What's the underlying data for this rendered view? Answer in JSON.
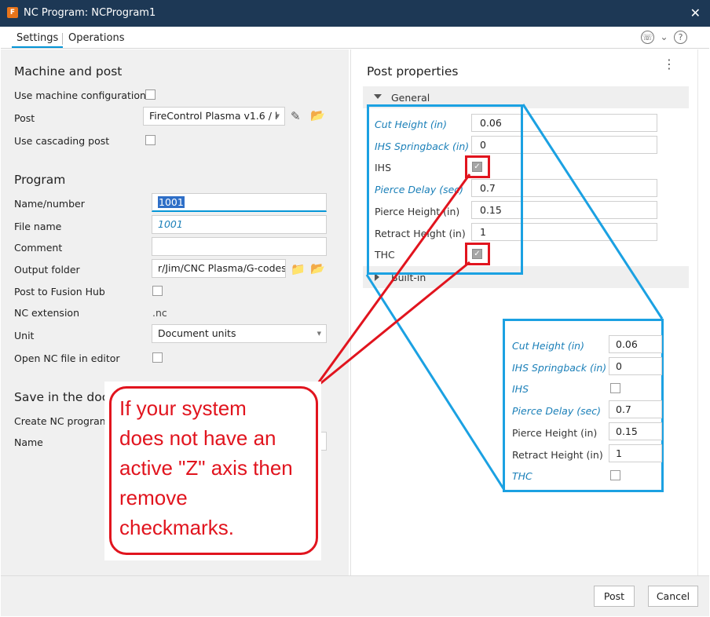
{
  "window": {
    "title": "NC Program: NCProgram1",
    "app_icon": "fusion-app-icon",
    "close_glyph": "✕"
  },
  "tabs": [
    {
      "label": "Settings",
      "active": true
    },
    {
      "label": "Operations",
      "active": false
    }
  ],
  "header_icons": {
    "support": "☏",
    "chevron": "⌄",
    "help": "?"
  },
  "machine_and_post": {
    "title": "Machine and post",
    "use_machine_config_label": "Use machine configuration",
    "post_label": "Post",
    "post_value": "FireControl Plasma v1.6 / l",
    "use_cascading_post_label": "Use cascading post"
  },
  "program": {
    "title": "Program",
    "name_label": "Name/number",
    "name_value": "1001",
    "file_name_label": "File name",
    "file_name_hint": "1001",
    "comment_label": "Comment",
    "comment_value": "",
    "output_folder_label": "Output folder",
    "output_folder_value": "r/Jim/CNC Plasma/G-codes",
    "post_to_hub_label": "Post to Fusion Hub",
    "nc_extension_label": "NC extension",
    "nc_extension_value": ".nc",
    "unit_label": "Unit",
    "unit_value": "Document units",
    "open_nc_label": "Open NC file in editor"
  },
  "save_in_doc": {
    "title": "Save in the doc",
    "create_nc_label": "Create NC program",
    "name_label": "Name"
  },
  "post_properties": {
    "title": "Post properties",
    "menu_glyph": "⋮",
    "general_group": "General",
    "builtin_group": "Built-in",
    "rows": [
      {
        "label": "Cut Height (in)",
        "value": "0.06",
        "type": "field",
        "italic": true
      },
      {
        "label": "IHS Springback (in)",
        "value": "0",
        "type": "field",
        "italic": true
      },
      {
        "label": "IHS",
        "value": "",
        "type": "checkbox",
        "checked": true,
        "italic": false
      },
      {
        "label": "Pierce Delay (sec)",
        "value": "0.7",
        "type": "field",
        "italic": true
      },
      {
        "label": "Pierce Height (in)",
        "value": "0.15",
        "type": "field",
        "italic": false
      },
      {
        "label": "Retract Height (in)",
        "value": "1",
        "type": "field",
        "italic": false
      },
      {
        "label": "THC",
        "value": "",
        "type": "checkbox",
        "checked": true,
        "italic": false
      }
    ]
  },
  "zoom_panel": {
    "rows": [
      {
        "label": "Cut Height (in)",
        "value": "0.06",
        "type": "field",
        "italic": true
      },
      {
        "label": "IHS Springback (in)",
        "value": "0",
        "type": "field",
        "italic": true
      },
      {
        "label": "IHS",
        "value": "",
        "type": "checkbox",
        "checked": false,
        "italic": true
      },
      {
        "label": "Pierce Delay (sec)",
        "value": "0.7",
        "type": "field",
        "italic": true
      },
      {
        "label": "Pierce Height (in)",
        "value": "0.15",
        "type": "field",
        "italic": false
      },
      {
        "label": "Retract Height (in)",
        "value": "1",
        "type": "field",
        "italic": false
      },
      {
        "label": "THC",
        "value": "",
        "type": "checkbox",
        "checked": false,
        "italic": true
      }
    ]
  },
  "callout": {
    "lines": [
      "If your system",
      "does not have an",
      "active \"Z\" axis then",
      "remove",
      "checkmarks."
    ]
  },
  "buttons": {
    "post": "Post",
    "cancel": "Cancel"
  },
  "icons": {
    "edit": "✎",
    "folder": "📂",
    "folder_eye": "📁",
    "dropdown": "▼",
    "check": "✓"
  },
  "colors": {
    "title_bar": "#1d3855",
    "accent": "#0696d7",
    "annotation_red": "#e1141e",
    "annotation_cyan": "#1ba1e2"
  }
}
